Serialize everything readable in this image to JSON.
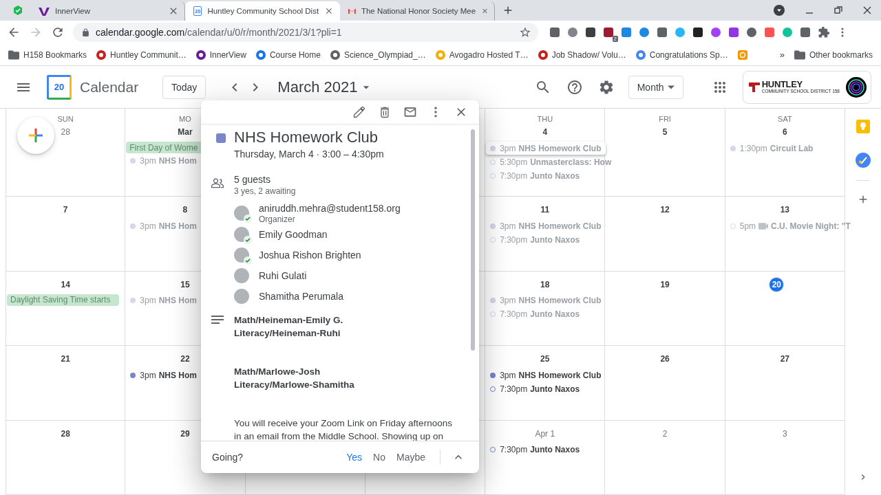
{
  "browser": {
    "tabs": [
      {
        "title": "InnerView",
        "selected": false
      },
      {
        "title": "Huntley Community School Dist",
        "selected": true,
        "icon_text": "20"
      },
      {
        "title": "The National Honor Society Mee",
        "selected": false
      }
    ],
    "url_host": "calendar.google.com",
    "url_path": "/calendar/u/0/r/month/2021/3/1?pli=1",
    "extension_badge": "2",
    "bookmarks": [
      {
        "label": "H158 Bookmarks"
      },
      {
        "label": "Huntley Communit…"
      },
      {
        "label": "InnerView"
      },
      {
        "label": "Course Home"
      },
      {
        "label": "Science_Olympiad_…"
      },
      {
        "label": "Avogadro Hosted T…"
      },
      {
        "label": "Job Shadow/ Volu…"
      },
      {
        "label": "Congratulations Sp…"
      }
    ],
    "more_bookmarks": "»",
    "other_bookmarks": "Other bookmarks"
  },
  "calendar": {
    "logo_date": "20",
    "app_name": "Calendar",
    "today_button": "Today",
    "month_title": "March 2021",
    "view": "Month",
    "district_logo": "HUNTLEY",
    "district_subtitle": "COMMUNITY SCHOOL DISTRICT 158",
    "weeks": [
      {
        "sun": {
          "day_name": "SUN",
          "date": "28",
          "today": false,
          "other_month": true
        },
        "mon": {
          "day_name": "MO",
          "date": "Mar",
          "today": false,
          "other_month": false,
          "events": [
            {
              "kind": "allday",
              "title": "First Day of Wome",
              "past": true
            },
            {
              "kind": "timed",
              "time": "3pm",
              "title": "NHS Hom",
              "outlined": false,
              "past": true,
              "selected": false
            }
          ]
        },
        "thu": {
          "day_name": "THU",
          "date": "4",
          "today": false,
          "other_month": false,
          "events": [
            {
              "kind": "timed",
              "time": "3pm",
              "title": "NHS Homework Club",
              "outlined": false,
              "past": true,
              "selected": true
            },
            {
              "kind": "timed",
              "time": "5:30pm",
              "title": "Unmasterclass: How",
              "outlined": true,
              "past": true,
              "selected": false
            },
            {
              "kind": "timed",
              "time": "7:30pm",
              "title": "Junto Naxos",
              "outlined": true,
              "past": true,
              "selected": false
            }
          ]
        },
        "fri": {
          "day_name": "FRI",
          "date": "5",
          "today": false,
          "other_month": false
        },
        "sat": {
          "day_name": "SAT",
          "date": "6",
          "today": false,
          "other_month": false,
          "events": [
            {
              "kind": "timed",
              "time": "1:30pm",
              "title": "Circuit Lab",
              "outlined": false,
              "past": true,
              "selected": false
            }
          ]
        }
      },
      {
        "sun": {
          "date": "7",
          "today": false,
          "other_month": false
        },
        "mon": {
          "date": "8",
          "today": false,
          "other_month": false,
          "events": [
            {
              "kind": "timed",
              "time": "3pm",
              "title": "NHS Hom",
              "outlined": false,
              "past": true,
              "selected": false
            }
          ]
        },
        "thu": {
          "date": "11",
          "today": false,
          "other_month": false,
          "events": [
            {
              "kind": "timed",
              "time": "3pm",
              "title": "NHS Homework Club",
              "outlined": false,
              "past": true,
              "selected": false
            },
            {
              "kind": "timed",
              "time": "7:30pm",
              "title": "Junto Naxos",
              "outlined": true,
              "past": true,
              "selected": false
            }
          ]
        },
        "fri": {
          "date": "12",
          "today": false,
          "other_month": false
        },
        "sat": {
          "date": "13",
          "today": false,
          "other_month": false,
          "events": [
            {
              "kind": "timed",
              "time": "5pm",
              "camera": true,
              "title": "C.U. Movie Night: \"T",
              "outlined": true,
              "past": true,
              "selected": false
            }
          ]
        }
      },
      {
        "sun": {
          "date": "14",
          "today": false,
          "other_month": false,
          "events": [
            {
              "kind": "allday",
              "title": "Daylight Saving Time starts",
              "past": true
            }
          ]
        },
        "mon": {
          "date": "15",
          "today": false,
          "other_month": false,
          "events": [
            {
              "kind": "timed",
              "time": "3pm",
              "title": "NHS Hom",
              "outlined": false,
              "past": true,
              "selected": false
            }
          ]
        },
        "thu": {
          "date": "18",
          "today": false,
          "other_month": false,
          "events": [
            {
              "kind": "timed",
              "time": "3pm",
              "title": "NHS Homework Club",
              "outlined": false,
              "past": true,
              "selected": false
            },
            {
              "kind": "timed",
              "time": "7:30pm",
              "title": "Junto Naxos",
              "outlined": true,
              "past": true,
              "selected": false
            }
          ]
        },
        "fri": {
          "date": "19",
          "today": false,
          "other_month": false
        },
        "sat": {
          "date": "20",
          "today": true,
          "other_month": false
        }
      },
      {
        "sun": {
          "date": "21",
          "today": false,
          "other_month": false
        },
        "mon": {
          "date": "22",
          "today": false,
          "other_month": false,
          "events": [
            {
              "kind": "timed",
              "time": "3pm",
              "title": "NHS Hom",
              "outlined": false,
              "past": false,
              "selected": false
            }
          ]
        },
        "thu": {
          "date": "25",
          "today": false,
          "other_month": false,
          "events": [
            {
              "kind": "timed",
              "time": "3pm",
              "title": "NHS Homework Club",
              "outlined": false,
              "past": false,
              "selected": false
            },
            {
              "kind": "timed",
              "time": "7:30pm",
              "title": "Junto Naxos",
              "outlined": true,
              "past": false,
              "selected": false
            }
          ]
        },
        "fri": {
          "date": "26",
          "today": false,
          "other_month": false
        },
        "sat": {
          "date": "27",
          "today": false,
          "other_month": false
        }
      },
      {
        "sun": {
          "date": "28",
          "today": false,
          "other_month": false
        },
        "mon": {
          "date": "29",
          "today": false,
          "other_month": false
        },
        "thu": {
          "date": "Apr 1",
          "today": false,
          "other_month": true,
          "events": [
            {
              "kind": "timed",
              "time": "7:30pm",
              "title": "Junto Naxos",
              "outlined": true,
              "past": false,
              "selected": false
            }
          ]
        },
        "fri": {
          "date": "2",
          "today": false,
          "other_month": true
        },
        "sat": {
          "date": "3",
          "today": false,
          "other_month": true
        }
      }
    ]
  },
  "event_popup": {
    "title": "NHS Homework Club",
    "when": "Thursday, March 4  ·  3:00 – 4:30pm",
    "guest_count": "5 guests",
    "guest_summary": "3 yes, 2 awaiting",
    "guests": [
      {
        "name": "aniruddh.mehra@student158.org",
        "role": "Organizer",
        "accepted": true
      },
      {
        "name": "Emily Goodman",
        "accepted": true
      },
      {
        "name": "Joshua Rishon Brighten",
        "accepted": true
      },
      {
        "name": "Ruhi Gulati",
        "accepted": false
      },
      {
        "name": "Shamitha Perumala",
        "accepted": false
      }
    ],
    "description": [
      {
        "bold": true,
        "lines": [
          "Math/Heineman-Emily G.",
          "Literacy/Heineman-Ruhi"
        ]
      },
      {
        "bold": true,
        "lines": [
          "Math/Marlowe-Josh",
          "Literacy/Marlowe-Shamitha"
        ]
      },
      {
        "bold": false,
        "lines": [
          "You will receive your Zoom Link on Friday afternoons in an email from the Middle School. Showing up on"
        ]
      }
    ],
    "rsvp_label": "Going?",
    "rsvp_options": [
      {
        "label": "Yes",
        "selected": true
      },
      {
        "label": "No",
        "selected": false
      },
      {
        "label": "Maybe",
        "selected": false
      }
    ]
  }
}
